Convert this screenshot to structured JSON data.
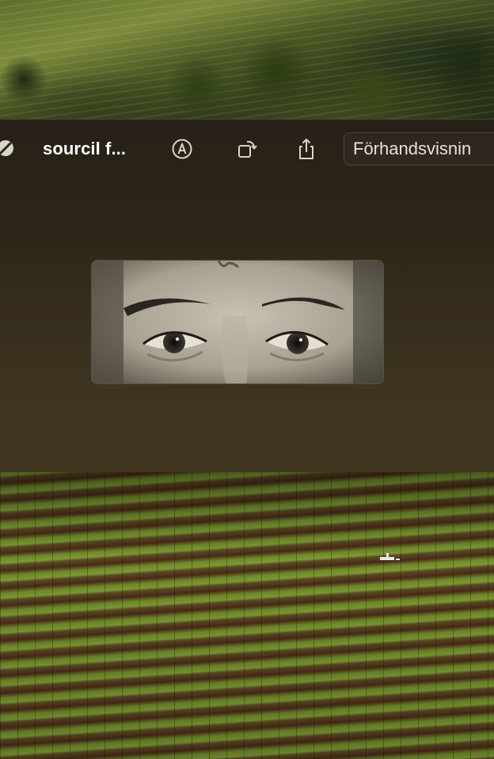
{
  "window": {
    "title": "sourcil f...",
    "open_with_label": "Förhandsvisnin",
    "accent": "#ffffff"
  },
  "toolbar": {
    "icons": [
      "lock-icon",
      "markup-icon",
      "rotate-icon",
      "share-icon"
    ]
  },
  "preview": {
    "subject": "eyes-photo"
  }
}
